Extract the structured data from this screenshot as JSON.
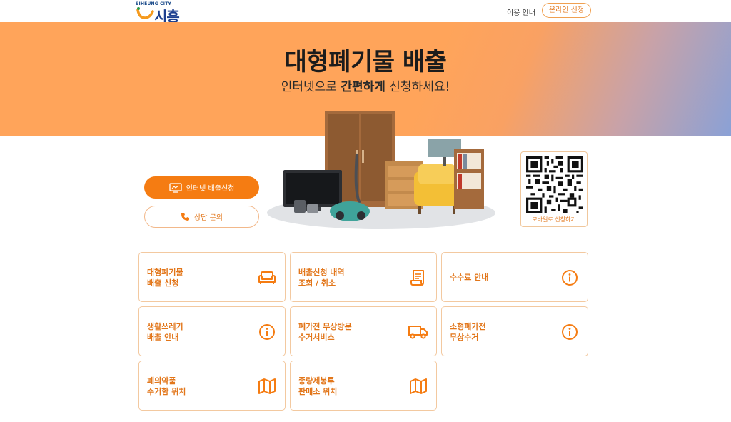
{
  "header": {
    "logo_small": "SIHEUNG CITY",
    "logo_text": "시흥",
    "nav_guide": "이용 안내",
    "nav_apply": "온라인 신청"
  },
  "hero": {
    "title": "대형폐기물 배출",
    "subtitle_pre": "인터넷으로 ",
    "subtitle_bold": "간편하게",
    "subtitle_post": " 신청하세요!"
  },
  "actions": {
    "internet_apply": "인터넷 배출신청",
    "consult": "상담 문의"
  },
  "qr": {
    "label": "모바일로 신청하기"
  },
  "cards": [
    {
      "label": "대형폐기물\n배출 신청",
      "icon": "sofa-icon"
    },
    {
      "label": "배출신청 내역\n조회 / 취소",
      "icon": "document-icon"
    },
    {
      "label": "수수료 안내",
      "icon": "info-icon"
    },
    {
      "label": "생활쓰레기\n배출 안내",
      "icon": "info-icon"
    },
    {
      "label": "폐가전 무상방문\n수거서비스",
      "icon": "truck-icon"
    },
    {
      "label": "소형폐가전\n무상수거",
      "icon": "info-icon"
    },
    {
      "label": "폐의약품\n수거함 위치",
      "icon": "map-icon"
    },
    {
      "label": "종량제봉투\n판매소 위치",
      "icon": "map-icon"
    }
  ],
  "colors": {
    "accent": "#f57c12",
    "accent_text": "#e2761a",
    "card_border": "#f3c9a0",
    "hero_orange": "#ffa45a",
    "hero_blue": "#8aa1d6"
  }
}
